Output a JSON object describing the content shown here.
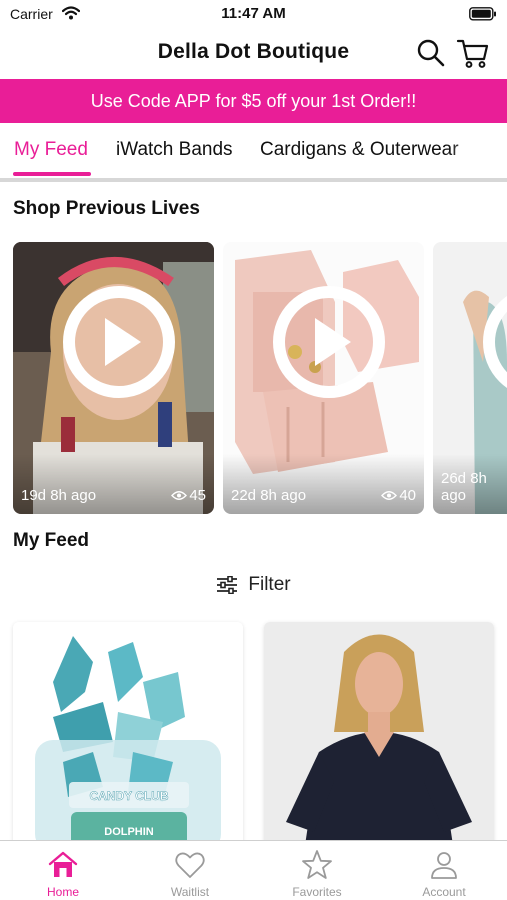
{
  "status_bar": {
    "carrier": "Carrier",
    "time": "11:47 AM"
  },
  "header": {
    "title": "Della Dot Boutique",
    "icons": [
      "search-icon",
      "cart-icon"
    ]
  },
  "promo": {
    "text": "Use Code APP for $5 off your 1st Order!!"
  },
  "tabs": [
    {
      "label": "My Feed",
      "active": true
    },
    {
      "label": "iWatch Bands",
      "active": false
    },
    {
      "label": "Cardigans & Outerwear",
      "active": false
    }
  ],
  "previous_lives": {
    "heading": "Shop Previous Lives",
    "items": [
      {
        "ago": "19d 8h ago",
        "views": "45"
      },
      {
        "ago": "22d 8h ago",
        "views": "40"
      },
      {
        "ago": "26d 8h ago",
        "views": ""
      }
    ]
  },
  "feed": {
    "heading": "My Feed",
    "filter_label": "Filter",
    "products": [
      {
        "jar_brand": "CANDY CLUB",
        "jar_flavor": "DOLPHIN"
      },
      {
        "jar_brand": "",
        "jar_flavor": ""
      }
    ]
  },
  "tabbar": [
    {
      "label": "Home",
      "icon": "home-icon",
      "active": true
    },
    {
      "label": "Waitlist",
      "icon": "heart-icon",
      "active": false
    },
    {
      "label": "Favorites",
      "icon": "star-icon",
      "active": false
    },
    {
      "label": "Account",
      "icon": "person-icon",
      "active": false
    }
  ],
  "colors": {
    "accent": "#e91e97",
    "inactive": "#9a9a9a"
  }
}
